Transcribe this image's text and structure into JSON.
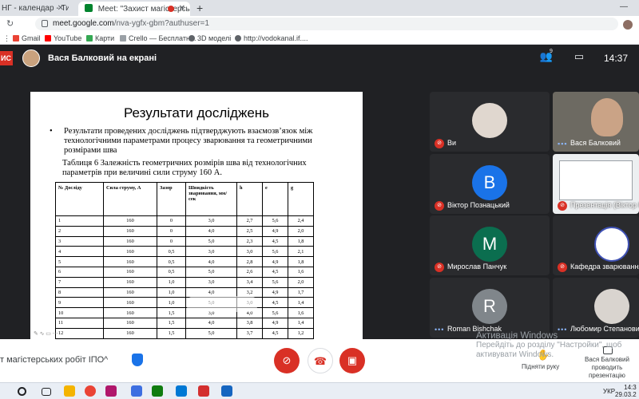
{
  "browser": {
    "tabs": [
      {
        "label": "НГ - календар - Тижден",
        "active": false
      },
      {
        "label": "Meet: \"Захист магістерські",
        "active": true
      }
    ],
    "new_tab": "+",
    "url_main": "meet.google.com",
    "url_rest": "/nva-ygfx-gbm?authuser=1",
    "bookmarks": [
      {
        "label": "Gmail",
        "icon": "gmail-icon",
        "color": "#ea4335"
      },
      {
        "label": "YouTube",
        "icon": "youtube-icon",
        "color": "#ff0000"
      },
      {
        "label": "Карти",
        "icon": "maps-icon",
        "color": "#34a853"
      },
      {
        "label": "Crello — Бесплатн...",
        "icon": "crello-icon",
        "color": "#9aa0a6"
      },
      {
        "label": "3D моделі",
        "icon": "globe-icon",
        "color": "#5f6368"
      },
      {
        "label": "http://vodokanal.if....",
        "icon": "globe-icon",
        "color": "#5f6368"
      }
    ]
  },
  "meet": {
    "presenting_badge": "ИС",
    "presenter_title": "Вася Балковий на екрані",
    "participants_count": "9",
    "time": "14:37",
    "meeting_title": "т магістерських робіт ІПО",
    "raise_hand_label": "Підняти руку",
    "presenting_label": "Вася Балковий проводить презентацію",
    "watermark_title": "Активація Windows",
    "watermark_text": "Перейдіть до розділу \"Настройки\", щоб активувати Windows."
  },
  "slide": {
    "title": "Результати досліджень",
    "bullet": "Результати проведених  досліджень  підтверджують взаємозв’язок між технологічними параметрами процесу зварювання  та геометричними розмірами  шва",
    "caption": "Таблиця 6 Залежність геометричних розмірів шва від  технологічних параметрів  при величині  сили струму 160 А.",
    "headers": [
      "№ Досліду",
      "Сила струму, А",
      "Зазор",
      "Швидкість зварювання, мм/сек",
      "h",
      "e",
      "g"
    ],
    "rows": [
      [
        "1",
        "160",
        "0",
        "3,0",
        "2,7",
        "5,6",
        "2,4"
      ],
      [
        "2",
        "160",
        "0",
        "4,0",
        "2,5",
        "4,9",
        "2,0"
      ],
      [
        "3",
        "160",
        "0",
        "5,0",
        "2,3",
        "4,5",
        "1,8"
      ],
      [
        "4",
        "160",
        "0,5",
        "3,0",
        "3,0",
        "5,6",
        "2,1"
      ],
      [
        "5",
        "160",
        "0,5",
        "4,0",
        "2,8",
        "4,9",
        "1,8"
      ],
      [
        "6",
        "160",
        "0,5",
        "5,0",
        "2,6",
        "4,5",
        "1,6"
      ],
      [
        "7",
        "160",
        "1,0",
        "3,0",
        "3,4",
        "5,6",
        "2,0"
      ],
      [
        "8",
        "160",
        "1,0",
        "4,0",
        "3,2",
        "4,9",
        "1,7"
      ],
      [
        "9",
        "160",
        "1,0",
        "5,0",
        "3,0",
        "4,5",
        "1,4"
      ],
      [
        "10",
        "160",
        "1,5",
        "3,0",
        "4,0",
        "5,6",
        "1,6"
      ],
      [
        "11",
        "160",
        "1,5",
        "4,0",
        "3,8",
        "4,9",
        "1,4"
      ],
      [
        "12",
        "160",
        "1,5",
        "5,0",
        "3,7",
        "4,5",
        "1,2"
      ]
    ]
  },
  "participants": [
    {
      "name": "Ви",
      "initial": "",
      "color": "#5f6368",
      "muted": true
    },
    {
      "name": "Вася Балковий",
      "initial": "",
      "color": "#6d6a62",
      "muted": false
    },
    {
      "name": "Віктор Познацький",
      "initial": "В",
      "color": "#1a73e8",
      "muted": true
    },
    {
      "name": "Презентація (Віктор Познацький)",
      "initial": "",
      "color": "#5f6368",
      "muted": true
    },
    {
      "name": "Мирослав Панчук",
      "initial": "M",
      "color": "#0b6e4f",
      "muted": true
    },
    {
      "name": "Кафедра зварювання",
      "initial": "",
      "color": "#ffffff",
      "muted": true
    },
    {
      "name": "Roman Bishchak",
      "initial": "R",
      "color": "#80868b",
      "muted": false
    },
    {
      "name": "Любомир Степанович",
      "initial": "",
      "color": "#d9d4cf",
      "muted": false
    }
  ],
  "taskbar": {
    "lang": "УКР",
    "time": "14:3",
    "date": "29.03.2"
  }
}
